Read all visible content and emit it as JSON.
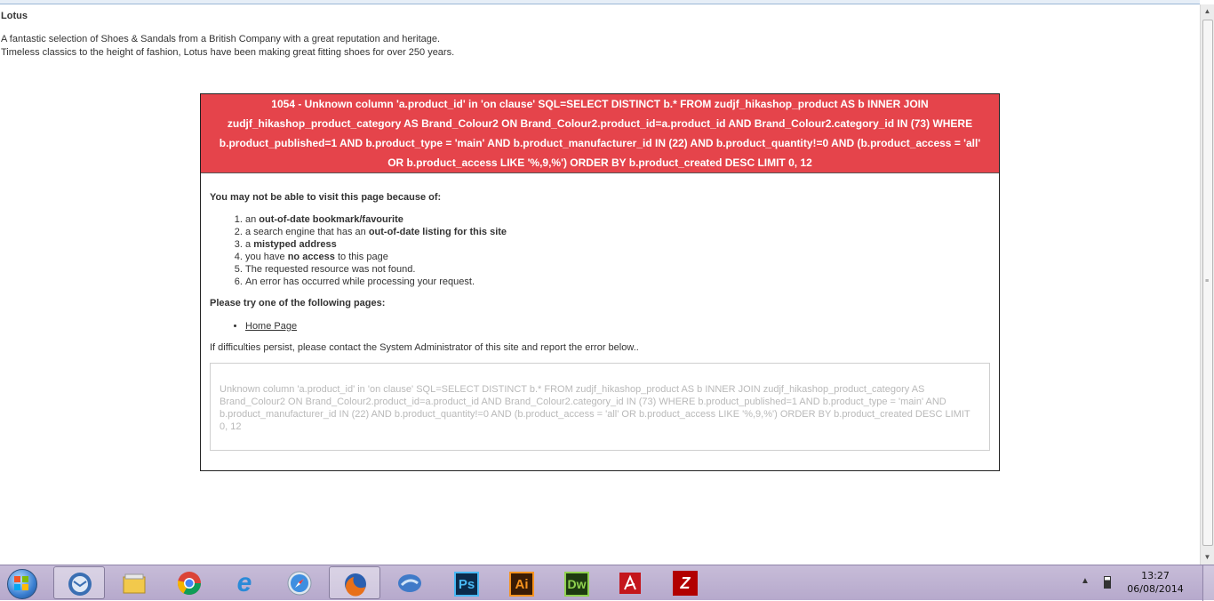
{
  "page": {
    "brand_title": "Lotus",
    "intro_line1": "A fantastic selection of Shoes & Sandals from a British Company with a great reputation and heritage.",
    "intro_line2": "Timeless classics to the height of fashion, Lotus have been making great fitting shoes for over 250 years."
  },
  "error": {
    "banner": "1054 - Unknown column 'a.product_id' in 'on clause' SQL=SELECT DISTINCT b.* FROM zudjf_hikashop_product AS b INNER JOIN zudjf_hikashop_product_category AS Brand_Colour2 ON Brand_Colour2.product_id=a.product_id AND Brand_Colour2.category_id IN (73) WHERE b.product_published=1 AND b.product_type = 'main' AND b.product_manufacturer_id IN (22) AND b.product_quantity!=0 AND (b.product_access = 'all' OR b.product_access LIKE '%,9,%') ORDER BY b.product_created DESC LIMIT 0, 12",
    "reasons_heading": "You may not be able to visit this page because of:",
    "reasons": [
      {
        "prefix": "an ",
        "bold": "out-of-date bookmark/favourite",
        "suffix": ""
      },
      {
        "prefix": "a search engine that has an ",
        "bold": "out-of-date listing for this site",
        "suffix": ""
      },
      {
        "prefix": "a ",
        "bold": "mistyped address",
        "suffix": ""
      },
      {
        "prefix": "you have ",
        "bold": "no access",
        "suffix": " to this page"
      },
      {
        "prefix": "The requested resource was not found.",
        "bold": "",
        "suffix": ""
      },
      {
        "prefix": "An error has occurred while processing your request.",
        "bold": "",
        "suffix": ""
      }
    ],
    "try_heading": "Please try one of the following pages:",
    "home_link": "Home Page",
    "persist_text": "If difficulties persist, please contact the System Administrator of this site and report the error below..",
    "detail": "Unknown column 'a.product_id' in 'on clause' SQL=SELECT DISTINCT b.* FROM zudjf_hikashop_product AS b INNER JOIN zudjf_hikashop_product_category AS Brand_Colour2 ON Brand_Colour2.product_id=a.product_id AND Brand_Colour2.category_id IN (73) WHERE b.product_published=1 AND b.product_type = 'main' AND b.product_manufacturer_id IN (22) AND b.product_quantity!=0 AND (b.product_access = 'all' OR b.product_access LIKE '%,9,%') ORDER BY b.product_created DESC LIMIT 0, 12"
  },
  "taskbar": {
    "icons": [
      "thunderbird-icon",
      "file-explorer-icon",
      "chrome-icon",
      "internet-explorer-icon",
      "safari-icon",
      "firefox-icon",
      "mail-icon",
      "photoshop-icon",
      "illustrator-icon",
      "dreamweaver-icon",
      "acrobat-icon",
      "filezilla-icon"
    ],
    "ps_label": "Ps",
    "ai_label": "Ai",
    "dw_label": "Dw",
    "fz_label": "Z",
    "clock_time": "13:27",
    "clock_date": "06/08/2014"
  },
  "colors": {
    "banner_bg": "#e5444b",
    "taskbar_bg": "#c7bcd8"
  }
}
